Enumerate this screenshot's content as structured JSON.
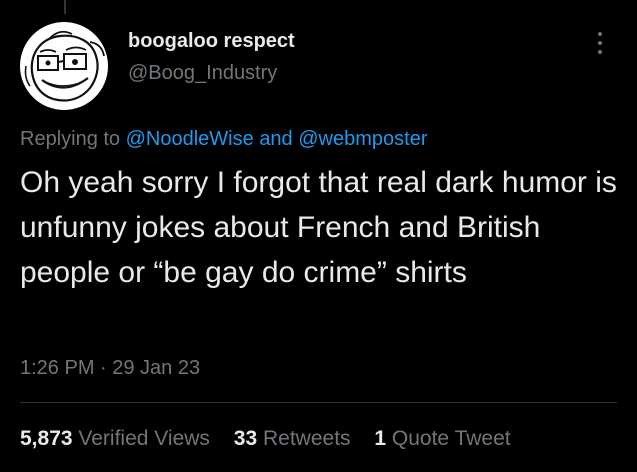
{
  "tweet": {
    "author": {
      "display_name": "boogaloo respect",
      "handle": "@Boog_Industry"
    },
    "more_icon": "more-options-icon",
    "replying": {
      "prefix": "Replying to",
      "mention1": "@NoodleWise",
      "conjunction": "and",
      "mention2": "@webmposter"
    },
    "text": "Oh yeah sorry I forgot that real dark humor is unfunny jokes about French and British people or “be gay do crime” shirts",
    "timestamp": "1:26 PM · 29 Jan 23",
    "stats": {
      "views_count": "5,873",
      "views_label": "Verified Views",
      "retweets_count": "33",
      "retweets_label": "Retweets",
      "quotes_count": "1",
      "quotes_label": "Quote Tweet"
    }
  },
  "colors": {
    "background": "#000000",
    "primary_text": "#e7e9ea",
    "secondary_text": "#71767b",
    "link": "#1d9bf0",
    "divider": "#2f3336"
  }
}
